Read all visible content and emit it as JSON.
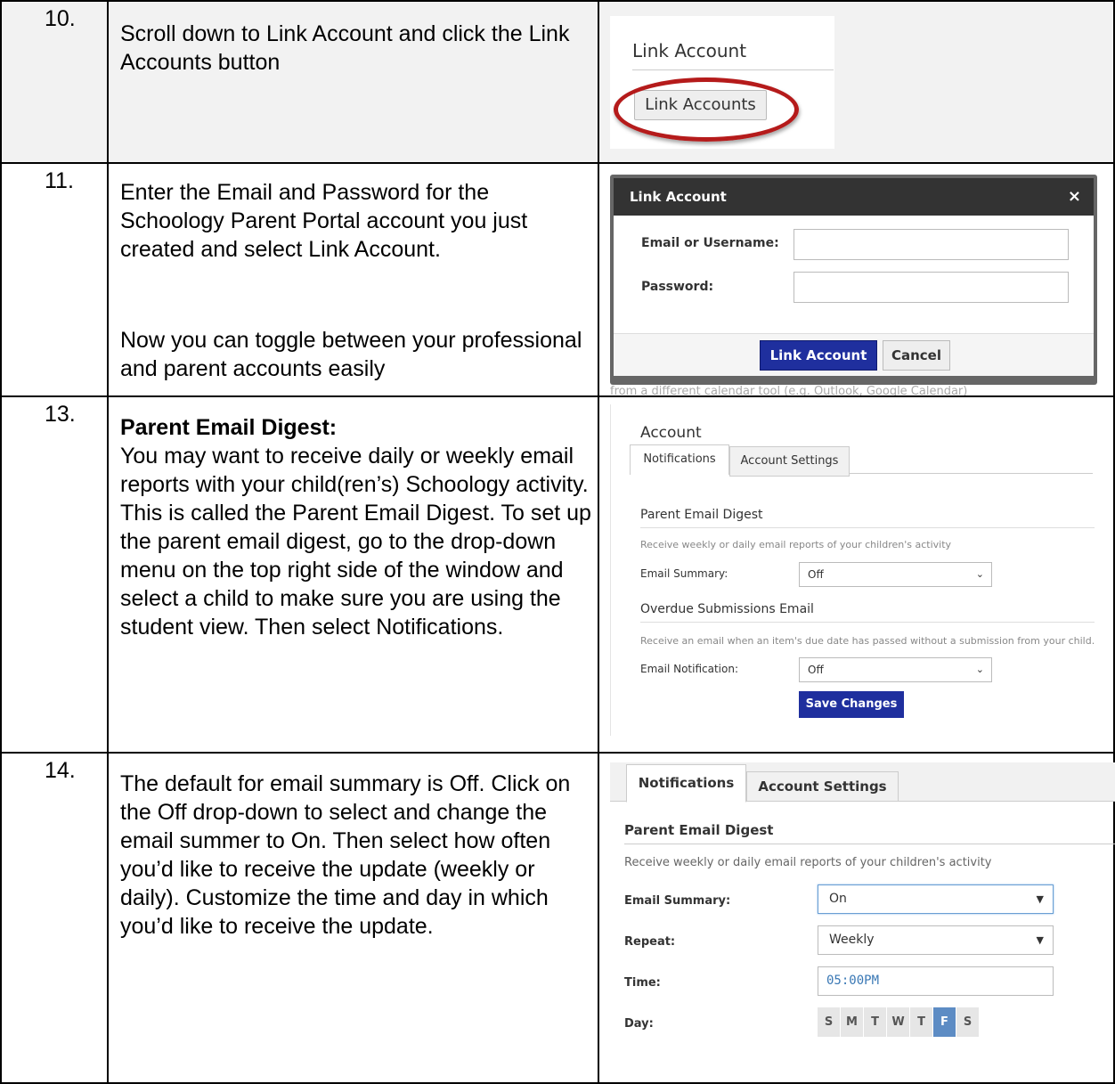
{
  "rows": [
    {
      "number": "10.",
      "text": "Scroll down to Link Account and click the  Link Accounts button"
    },
    {
      "number": "11.",
      "text": "Enter the Email and Password for the Schoology Parent Portal account you just created and select Link Account.",
      "note": "Now you can toggle between your professional and parent accounts easily"
    },
    {
      "number": "13.",
      "heading": "Parent Email Digest:",
      "text": "You may want to receive daily or weekly email reports with your child(ren’s) Schoology activity. This is called the Parent Email Digest. To set up the parent email digest, go to the drop-down menu on the top right side of the window and select a child to make sure you are using the student view. Then select Notifications."
    },
    {
      "number": "14.",
      "text": "The default for email summary is Off.  Click on the Off drop-down to select and change the email summer to On.  Then select how often you’d like to receive the update (weekly or daily).  Customize the time and day in which you’d like to receive the update."
    }
  ],
  "screenshot10": {
    "section_title": "Link Account",
    "button_label": "Link Accounts",
    "highlight_color": "#b51b1b"
  },
  "screenshot11": {
    "modal_title": "Link Account",
    "close_glyph": "×",
    "email_label": "Email or Username:",
    "email_value": "",
    "password_label": "Password:",
    "password_value": "",
    "submit_label": "Link Account",
    "cancel_label": "Cancel",
    "background_text": "from a different calendar tool (e.g. Outlook, Google Calendar)"
  },
  "screenshot13": {
    "title": "Account",
    "tabs": [
      "Notifications",
      "Account Settings"
    ],
    "digest_heading": "Parent Email Digest",
    "digest_description": "Receive weekly or daily email reports of your children's activity",
    "summary_label": "Email Summary:",
    "summary_value": "Off",
    "overdue_heading": "Overdue Submissions Email",
    "overdue_description": "Receive an email when an item's due date has passed without a submission from your child.",
    "notification_label": "Email Notification:",
    "notification_value": "Off",
    "save_label": "Save Changes",
    "button_color": "#1f2f9e"
  },
  "screenshot14": {
    "tabs": [
      "Notifications",
      "Account Settings"
    ],
    "digest_heading": "Parent Email Digest",
    "digest_description": "Receive weekly or daily email reports of your children's activity",
    "summary_label": "Email Summary:",
    "summary_value": "On",
    "repeat_label": "Repeat:",
    "repeat_value": "Weekly",
    "time_label": "Time:",
    "time_value": "05:00PM",
    "day_label": "Day:",
    "days": [
      "S",
      "M",
      "T",
      "W",
      "T",
      "F",
      "S"
    ],
    "selected_day": "F"
  }
}
